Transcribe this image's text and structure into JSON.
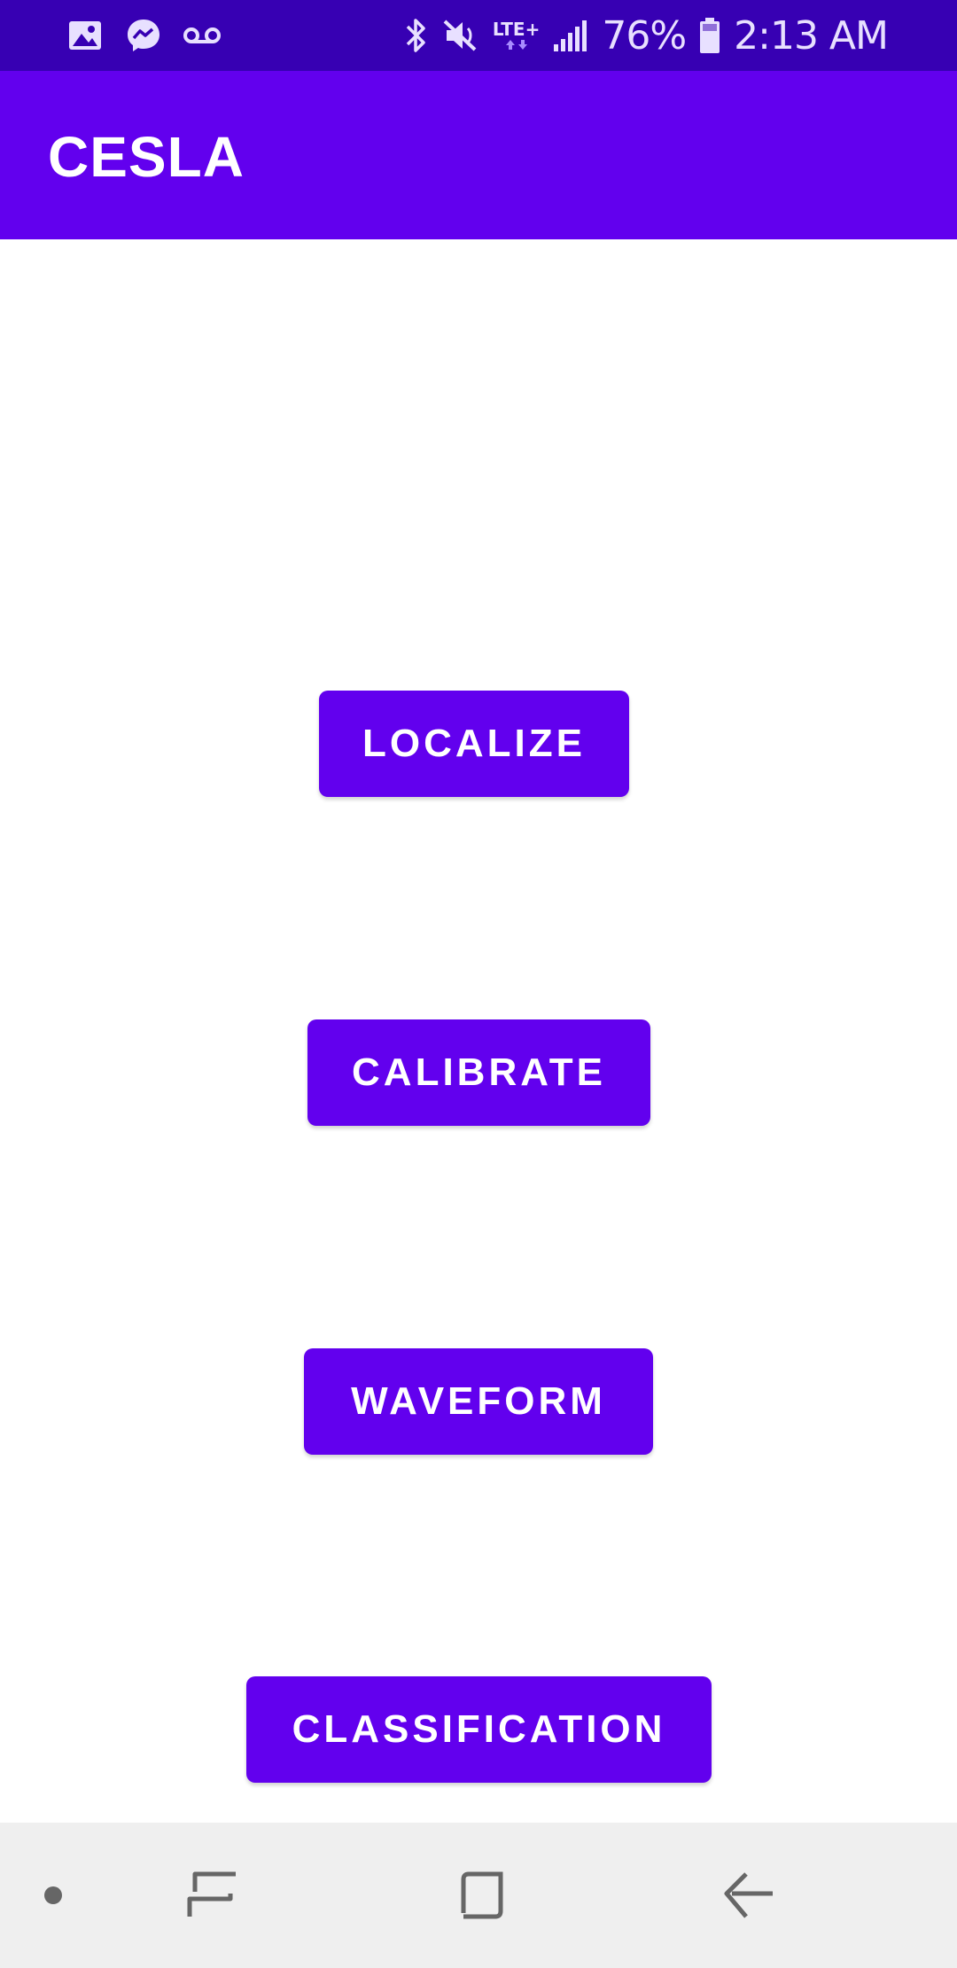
{
  "status_bar": {
    "left_icons": [
      "gallery-icon",
      "messenger-icon",
      "voicemail-icon"
    ],
    "right_icons": [
      "bluetooth-icon",
      "mute-icon",
      "lte-icon",
      "signal-icon"
    ],
    "network_label": "LTE+",
    "battery_percent": "76%",
    "time": "2:13 AM"
  },
  "app_bar": {
    "title": "CESLA"
  },
  "buttons": {
    "localize": "LOCALIZE",
    "calibrate": "CALIBRATE",
    "waveform": "WAVEFORM",
    "classification": "CLASSIFICATION"
  },
  "nav_bar": {
    "items": [
      "dot-icon",
      "recents-icon",
      "home-icon",
      "back-icon"
    ]
  },
  "colors": {
    "status_bar": "#3700b3",
    "primary": "#6200ee",
    "nav_bar": "#efefef",
    "nav_icon": "#666666"
  }
}
